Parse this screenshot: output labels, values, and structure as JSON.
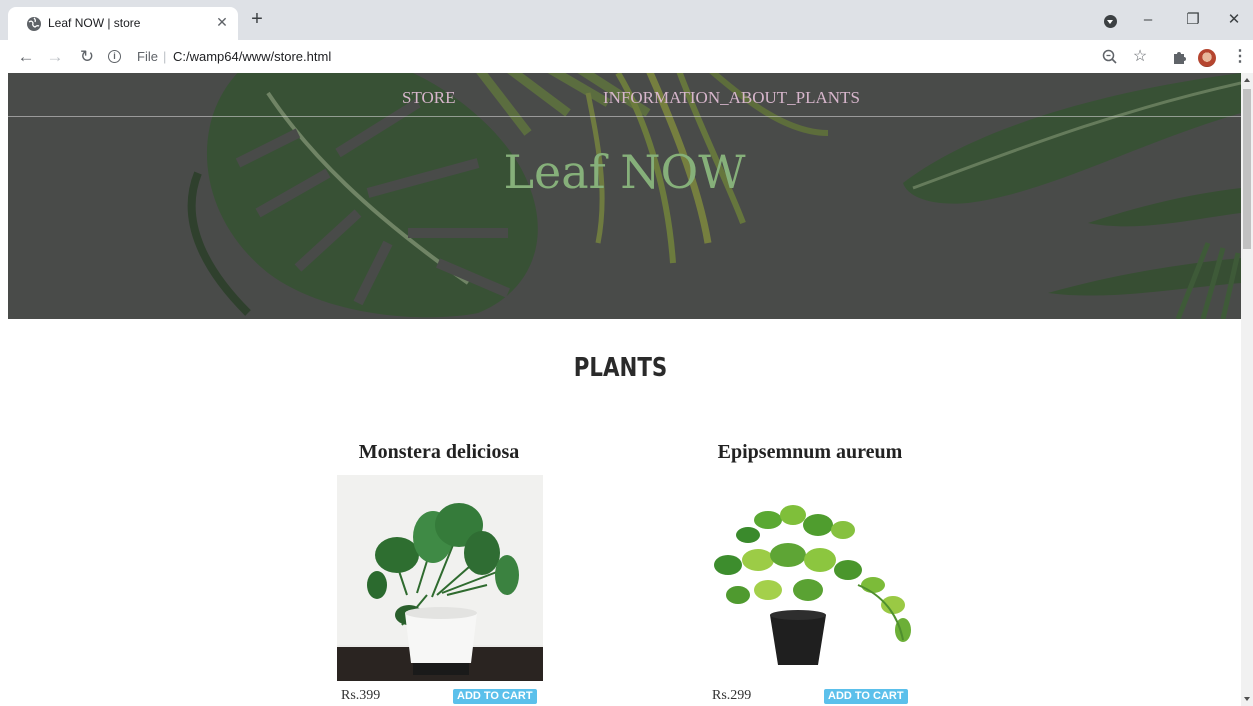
{
  "browser": {
    "tab_title": "Leaf NOW | store",
    "tab_close": "✕",
    "new_tab": "+",
    "url_scheme": "File",
    "url_separator": "|",
    "url": "C:/wamp64/www/store.html",
    "window_controls": {
      "minimize": "–",
      "restore": "❐",
      "close": "✕"
    }
  },
  "site_nav": {
    "links": [
      {
        "label": "STORE"
      },
      {
        "label": "INFORMATION_ABOUT_PLANTS"
      }
    ],
    "link_color": "#d7b6cc"
  },
  "hero": {
    "title": "Leaf NOW",
    "title_color": "#86b07a"
  },
  "section_title": "PLANTS",
  "products": [
    {
      "name": "Monstera deliciosa",
      "price": "Rs.399",
      "cta": "ADD TO CART"
    },
    {
      "name": "Epipsemnum aureum",
      "price": "Rs.299",
      "cta": "ADD TO CART"
    }
  ],
  "colors": {
    "cart_button": "#5bc0eb",
    "tabstrip": "#dee1e6"
  }
}
